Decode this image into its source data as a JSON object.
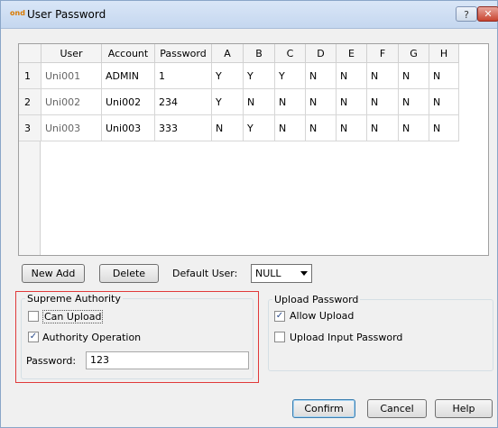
{
  "window": {
    "title": "User Password",
    "app_icon": "ond",
    "help_label": "?",
    "close_label": "✕"
  },
  "table": {
    "columns": [
      "User",
      "Account",
      "Password",
      "A",
      "B",
      "C",
      "D",
      "E",
      "F",
      "G",
      "H"
    ],
    "rows": [
      [
        "1",
        "Uni001",
        "ADMIN",
        "1",
        "Y",
        "Y",
        "Y",
        "N",
        "N",
        "N",
        "N",
        "N"
      ],
      [
        "2",
        "Uni002",
        "Uni002",
        "234",
        "Y",
        "N",
        "N",
        "N",
        "N",
        "N",
        "N",
        "N"
      ],
      [
        "3",
        "Uni003",
        "Uni003",
        "333",
        "N",
        "Y",
        "N",
        "N",
        "N",
        "N",
        "N",
        "N"
      ]
    ]
  },
  "toolbar": {
    "new_add": "New Add",
    "delete": "Delete",
    "default_user_label": "Default User:",
    "default_user_value": "NULL"
  },
  "supreme": {
    "title": "Supreme Authority",
    "can_upload": {
      "label": "Can Upload",
      "checked": false
    },
    "authority_operation": {
      "label": "Authority Operation",
      "checked": true
    },
    "password_label": "Password:",
    "password_value": "123"
  },
  "upload": {
    "title": "Upload Password",
    "allow_upload": {
      "label": "Allow Upload",
      "checked": true
    },
    "upload_input_password": {
      "label": "Upload Input Password",
      "checked": false
    }
  },
  "footer": {
    "confirm": "Confirm",
    "cancel": "Cancel",
    "help": "Help"
  },
  "icons": {
    "check": "check-icon",
    "dropdown": "chevron-down-icon"
  },
  "colors": {
    "highlight_frame": "#e03a3a",
    "titlebar": "#c5d7ef"
  }
}
